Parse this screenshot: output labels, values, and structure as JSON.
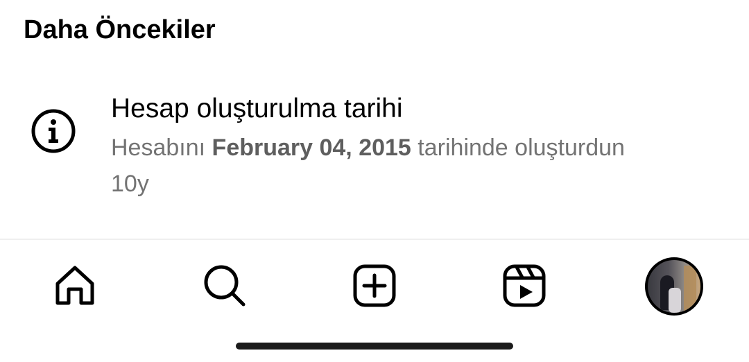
{
  "section": {
    "title": "Daha Öncekiler"
  },
  "activity": {
    "icon": "info-icon",
    "title": "Hesap oluşturulma tarihi",
    "desc_prefix": "Hesabını",
    "desc_date": "February 04, 2015",
    "desc_suffix": "tarihinde oluşturdun",
    "age": "10y"
  },
  "tabbar": {
    "items": [
      {
        "name": "home",
        "icon": "home-icon"
      },
      {
        "name": "search",
        "icon": "search-icon"
      },
      {
        "name": "create",
        "icon": "plus-square-icon"
      },
      {
        "name": "reels",
        "icon": "reels-icon"
      },
      {
        "name": "profile",
        "icon": "avatar"
      }
    ]
  }
}
